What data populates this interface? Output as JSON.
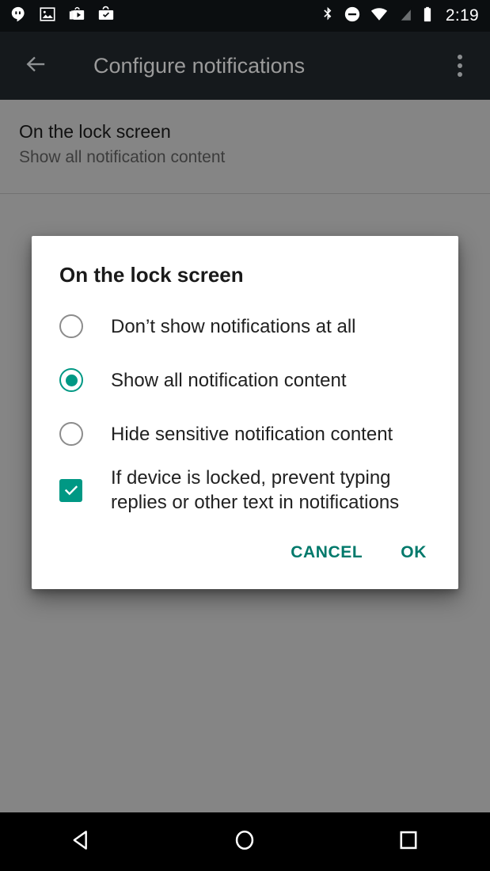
{
  "status_bar": {
    "time": "2:19",
    "left_icons": [
      {
        "name": "hangouts-icon",
        "label": "Hangouts"
      },
      {
        "name": "photo-icon",
        "label": "Photos"
      },
      {
        "name": "play-store-icon",
        "label": "Play Store"
      },
      {
        "name": "work-checkmark-icon",
        "label": "Work app installed"
      }
    ],
    "right_icons": [
      {
        "name": "bluetooth-icon",
        "label": "Bluetooth"
      },
      {
        "name": "do-not-disturb-icon",
        "label": "Do not disturb"
      },
      {
        "name": "wifi-icon",
        "label": "Wi-Fi"
      },
      {
        "name": "no-signal-icon",
        "label": "No SIM signal"
      },
      {
        "name": "battery-icon",
        "label": "Battery"
      }
    ]
  },
  "toolbar": {
    "title": "Configure notifications",
    "back_icon": "arrow-back-icon",
    "overflow_icon": "more-vert-icon"
  },
  "settings_list": {
    "items": [
      {
        "title": "On the lock screen",
        "subtitle": "Show all notification content"
      }
    ]
  },
  "dialog": {
    "title": "On the lock screen",
    "options": [
      {
        "type": "radio",
        "label": "Don’t show notifications at all",
        "checked": false
      },
      {
        "type": "radio",
        "label": "Show all notification content",
        "checked": true
      },
      {
        "type": "radio",
        "label": "Hide sensitive notification content",
        "checked": false
      },
      {
        "type": "checkbox",
        "label": "If device is locked, prevent typing replies or other text in notifications",
        "checked": true
      }
    ],
    "buttons": {
      "cancel": "CANCEL",
      "ok": "OK"
    }
  },
  "nav_bar": {
    "back": "back-triangle-icon",
    "home": "home-circle-icon",
    "recents": "recents-square-icon"
  },
  "colors": {
    "accent": "#009884",
    "button_text": "#00796b",
    "status_bar_bg": "#0b0e10",
    "toolbar_bg": "#15191c",
    "toolbar_title": "#9b9b9b",
    "nav_bar_bg": "#000000",
    "dialog_bg": "#ffffff"
  }
}
